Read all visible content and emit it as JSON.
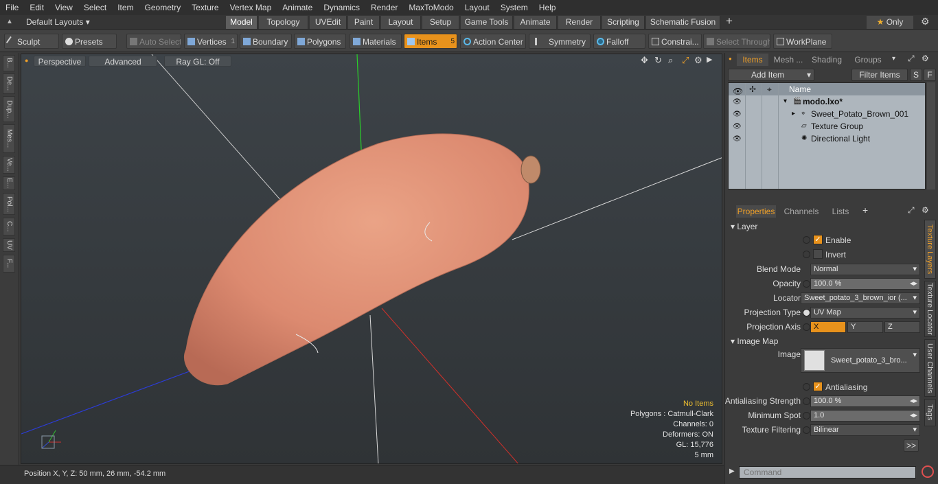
{
  "menu": [
    "File",
    "Edit",
    "View",
    "Select",
    "Item",
    "Geometry",
    "Texture",
    "Vertex Map",
    "Animate",
    "Dynamics",
    "Render",
    "MaxToModo",
    "Layout",
    "System",
    "Help"
  ],
  "layout_dropdown": "Default Layouts",
  "tabs": [
    "Model",
    "Topology",
    "UVEdit",
    "Paint",
    "Layout",
    "Setup",
    "Game Tools",
    "Animate",
    "Render",
    "Scripting",
    "Schematic Fusion"
  ],
  "tabs_add": "+",
  "only_label": "Only",
  "toolbar": {
    "sculpt": "Sculpt",
    "presets": "Presets",
    "auto_select": "Auto Select",
    "vertices": "Vertices",
    "vertices_count": "1",
    "boundary": "Boundary",
    "polygons": "Polygons",
    "materials": "Materials",
    "items": "Items",
    "items_count": "5",
    "action_center": "Action Center",
    "symmetry": "Symmetry",
    "falloff": "Falloff",
    "constraints": "Constrai...",
    "select_through": "Select Through",
    "workplane": "WorkPlane"
  },
  "left_tabs": [
    "B...",
    "De...",
    "Dup...",
    "Mes...",
    "Ve...",
    "E...",
    "Pol...",
    "C...",
    "UV",
    "F..."
  ],
  "viewport": {
    "perspective": "Perspective",
    "advanced": "Advanced",
    "raygl": "Ray GL: Off",
    "info": {
      "no_items": "No Items",
      "polygons": "Polygons : Catmull-Clark",
      "channels": "Channels: 0",
      "deformers": "Deformers: ON",
      "gl": "GL: 15,776",
      "scale": "5 mm"
    }
  },
  "status": "Position X, Y, Z:  50 mm, 26 mm, -54.2 mm",
  "panel_tabs": [
    "Items",
    "Mesh ...",
    "Shading",
    "Groups"
  ],
  "add_item": "Add Item",
  "filter_items": "Filter Items",
  "s_btn": "S",
  "f_btn": "F",
  "list_header": "Name",
  "items": [
    {
      "name": "modo.lxo*",
      "indent": 0
    },
    {
      "name": "Sweet_Potato_Brown_001",
      "indent": 1
    },
    {
      "name": "Texture Group",
      "indent": 1
    },
    {
      "name": "Directional Light",
      "indent": 1
    }
  ],
  "prop_tabs": [
    "Properties",
    "Channels",
    "Lists"
  ],
  "prop_add": "+",
  "props": {
    "layer": "Layer",
    "enable": "Enable",
    "invert": "Invert",
    "blend_mode_label": "Blend Mode",
    "blend_mode": "Normal",
    "opacity_label": "Opacity",
    "opacity": "100.0 %",
    "locator_label": "Locator",
    "locator": "Sweet_potato_3_brown_ior (...",
    "projection_type_label": "Projection Type",
    "projection_type": "UV Map",
    "projection_axis_label": "Projection Axis",
    "axis_x": "X",
    "axis_y": "Y",
    "axis_z": "Z",
    "image_map": "Image Map",
    "image_label": "Image",
    "image": "Sweet_potato_3_bro...",
    "antialiasing": "Antialiasing",
    "aa_strength_label": "Antialiasing Strength",
    "aa_strength": "100.0 %",
    "min_spot_label": "Minimum Spot",
    "min_spot": "1.0",
    "tex_filter_label": "Texture Filtering",
    "tex_filter": "Bilinear",
    "more": ">>"
  },
  "right_vtabs": [
    "Texture Layers",
    "Texture Locator",
    "User Channels",
    "Tags"
  ],
  "command_placeholder": "Command"
}
